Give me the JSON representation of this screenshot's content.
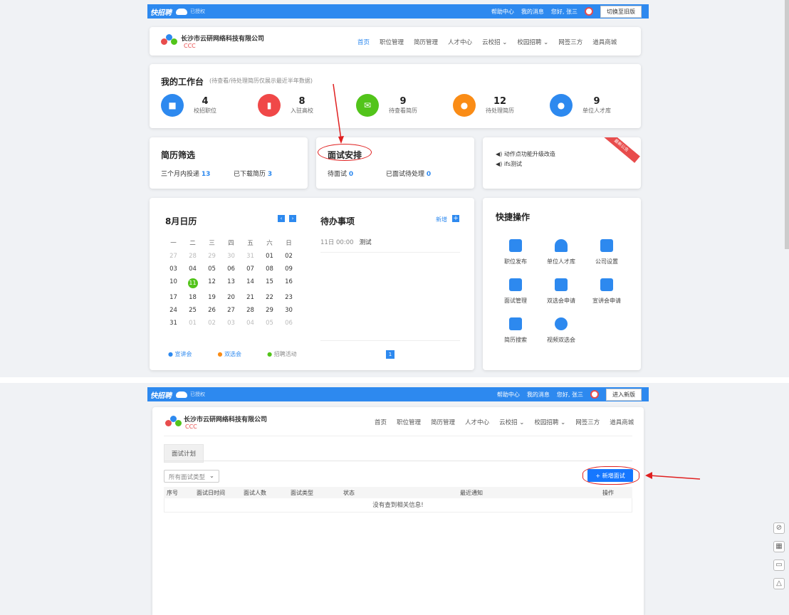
{
  "top1": {
    "logo": "快招聘",
    "sublogo": "已授权",
    "help": "帮助中心",
    "messages": "我的消息",
    "greeting": "您好, 张三",
    "switch": "切换至旧版"
  },
  "top2": {
    "logo": "快招聘",
    "sublogo": "已授权",
    "help": "帮助中心",
    "messages": "我的消息",
    "greeting": "您好, 张三",
    "switch": "进入新版"
  },
  "company": {
    "name": "长沙市云研网络科技有限公司",
    "sub": "CCC"
  },
  "nav": [
    "首页",
    "职位管理",
    "简历管理",
    "人才中心",
    "云校招 ⌄",
    "校园招聘 ⌄",
    "网签三方",
    "道具商城"
  ],
  "workbench": {
    "title": "我的工作台",
    "note": "(待查看/待处理简历仅展示最近半年数据)",
    "stats": [
      {
        "num": "4",
        "label": "校招职位",
        "color": "#2d89ef",
        "icon": "briefcase-icon"
      },
      {
        "num": "8",
        "label": "入驻高校",
        "color": "#f04848",
        "icon": "building-icon"
      },
      {
        "num": "9",
        "label": "待查看简历",
        "color": "#52c41a",
        "icon": "mail-icon"
      },
      {
        "num": "12",
        "label": "待处理简历",
        "color": "#fa8c16",
        "icon": "chat-icon"
      },
      {
        "num": "9",
        "label": "单位人才库",
        "color": "#2d89ef",
        "icon": "user-icon"
      }
    ]
  },
  "resume": {
    "title": "简历筛选",
    "l1": "三个月内投递",
    "v1": "13",
    "l2": "已下载简历",
    "v2": "3"
  },
  "interview": {
    "title": "面试安排",
    "l1": "待面试",
    "v1": "0",
    "l2": "已面试待处理",
    "v2": "0"
  },
  "notice": {
    "items": [
      "动作点功能升级改造",
      "ifs测试"
    ],
    "ribbon": "最新公告"
  },
  "calendar": {
    "title": "8月日历",
    "weekdays": [
      "一",
      "二",
      "三",
      "四",
      "五",
      "六",
      "日"
    ],
    "rows": [
      [
        "27",
        "28",
        "29",
        "30",
        "31",
        "01",
        "02"
      ],
      [
        "03",
        "04",
        "05",
        "06",
        "07",
        "08",
        "09"
      ],
      [
        "10",
        "11",
        "12",
        "13",
        "14",
        "15",
        "16"
      ],
      [
        "17",
        "18",
        "19",
        "20",
        "21",
        "22",
        "23"
      ],
      [
        "24",
        "25",
        "26",
        "27",
        "28",
        "29",
        "30"
      ],
      [
        "31",
        "01",
        "02",
        "03",
        "04",
        "05",
        "06"
      ]
    ],
    "legend": [
      "宣讲会",
      "双选会",
      "招聘活动"
    ]
  },
  "todo": {
    "title": "待办事项",
    "add": "新增",
    "item_time": "11日 00:00",
    "item_text": "测试",
    "page": "1"
  },
  "quick": {
    "title": "快捷操作",
    "items": [
      "职位发布",
      "单位人才库",
      "公司设置",
      "面试管理",
      "双选会申请",
      "宣讲会申请",
      "简历搜索",
      "视频双选会"
    ]
  },
  "plan": {
    "tab": "面试计划",
    "select": "所有面试类型",
    "add_btn": "+ 新增面试",
    "columns": [
      "序号",
      "面试日时间",
      "面试人数",
      "面试类型",
      "状态",
      "最近通知",
      "操作"
    ],
    "empty": "没有查到相关信息!"
  }
}
